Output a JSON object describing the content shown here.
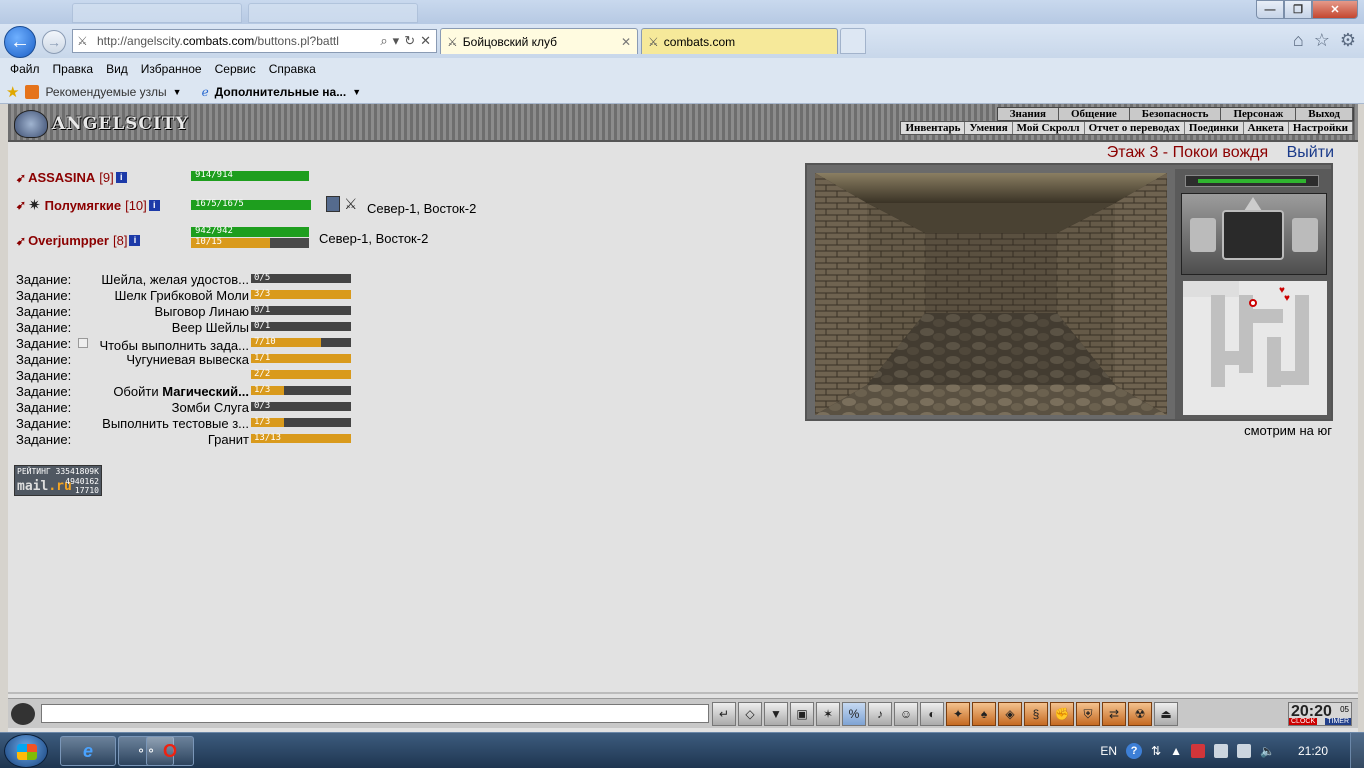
{
  "browser": {
    "url_prefix": "http://angelscity.",
    "url_domain": "combats.com",
    "url_suffix": "/buttons.pl?battl",
    "tabs": [
      {
        "label": "Бойцовский клуб",
        "active": true
      },
      {
        "label": "combats.com",
        "active": false
      }
    ],
    "menu": [
      "Файл",
      "Правка",
      "Вид",
      "Избранное",
      "Сервис",
      "Справка"
    ],
    "favorites": {
      "suggested": "Рекомендуемые узлы",
      "addons": "Дополнительные на..."
    }
  },
  "game": {
    "logo": "ANGELSCITY",
    "top_nav": [
      "Знания",
      "Общение",
      "Безопасность",
      "Персонаж",
      "Выход"
    ],
    "sub_nav": [
      "Инвентарь",
      "Умения",
      "Мой Скролл",
      "Отчет о переводах",
      "Поединки",
      "Анкета",
      "Настройки"
    ],
    "players": [
      {
        "nick": "ASSASINA",
        "level": "[9]",
        "hp_text": "914/914",
        "hp_fraction": 1.0,
        "coords": ""
      },
      {
        "nick": "Полумягкие",
        "level": "[10]",
        "hp_text": "1675/1675",
        "hp_fraction": 1.0,
        "coords": "Север-1, Восток-2"
      },
      {
        "nick": "Overjumpper",
        "level": "[8]",
        "hp_text": "942/942",
        "hp_fraction": 1.0,
        "mana_text": "10/15",
        "mana_fraction": 0.667,
        "coords": "Север-1, Восток-2"
      }
    ],
    "task_label": "Задание:",
    "tasks": [
      {
        "name": "Шейла, желая удостов...",
        "bold": "",
        "progress": "0/5",
        "fraction": 0.0,
        "color": "gold"
      },
      {
        "name": "Шелк Грибковой Моли",
        "bold": "",
        "progress": "3/3",
        "fraction": 1.0,
        "color": "gold"
      },
      {
        "name": "Выговор Линаю",
        "bold": "",
        "progress": "0/1",
        "fraction": 0.0,
        "color": "gold"
      },
      {
        "name": "Веер Шейлы",
        "bold": "",
        "progress": "0/1",
        "fraction": 0.0,
        "color": "gold"
      },
      {
        "name": "Чтобы выполнить зада...",
        "bold": "",
        "progress": "7/10",
        "fraction": 0.7,
        "color": "gold"
      },
      {
        "name": "Чугуниевая вывеска",
        "bold": "",
        "progress": "1/1",
        "fraction": 1.0,
        "color": "gold"
      },
      {
        "name": "",
        "bold": "",
        "progress": "2/2",
        "fraction": 1.0,
        "color": "gold"
      },
      {
        "name": "Обойти ",
        "bold": "Магический...",
        "progress": "1/3",
        "fraction": 0.333,
        "color": "gold"
      },
      {
        "name": "Зомби Слуга",
        "bold": "",
        "progress": "0/3",
        "fraction": 0.0,
        "color": "gold"
      },
      {
        "name": "Выполнить тестовые з...",
        "bold": "",
        "progress": "1/3",
        "fraction": 0.333,
        "color": "gold"
      },
      {
        "name": "Гранит",
        "bold": "",
        "progress": "13/13",
        "fraction": 1.0,
        "color": "gold"
      }
    ],
    "counter": {
      "rating_label": "РЕЙТИНГ",
      "rating_value": "33541809K",
      "brand_a": "mail",
      "brand_b": ".ru",
      "line1": "4940162",
      "line2": "17710"
    },
    "location": {
      "name": "Этаж 3 - Покои вождя",
      "exit": "Выйти"
    },
    "facing": "смотрим на юг",
    "clock": {
      "time": "20:20",
      "sec": "05",
      "clock_label": "CLOCK",
      "timer_label": "TIMER"
    }
  },
  "taskbar": {
    "lang": "EN",
    "time": "21:20"
  }
}
